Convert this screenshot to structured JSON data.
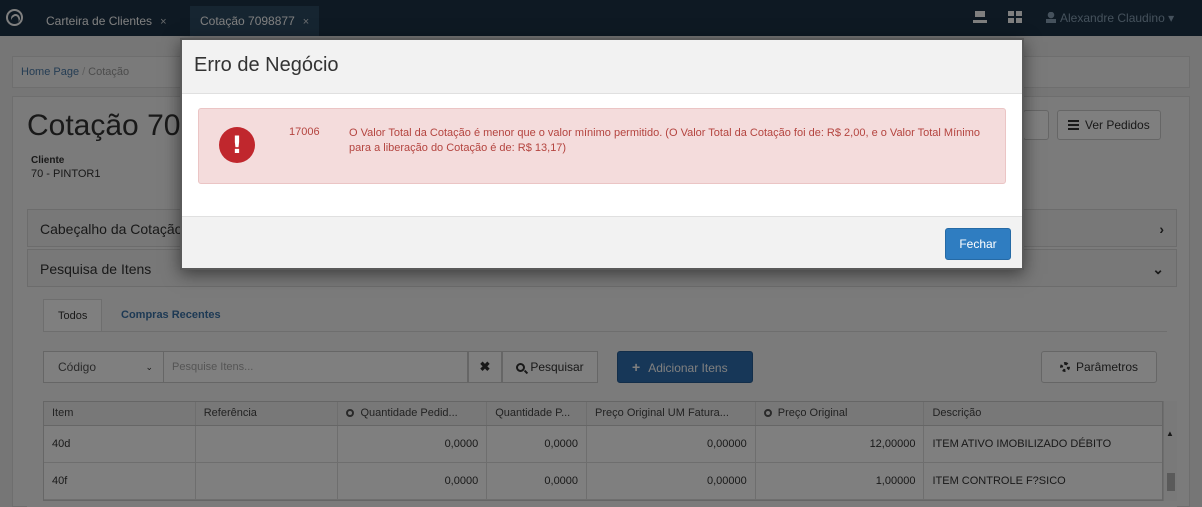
{
  "topbar": {
    "tabs": [
      {
        "label": "Carteira de Clientes",
        "close": "×"
      },
      {
        "label": "Cotação 7098877",
        "close": "×"
      }
    ],
    "user": "Alexandre Claudino",
    "user_caret": "▾"
  },
  "breadcrumb": {
    "home": "Home Page",
    "sep": "/",
    "current": "Cotação"
  },
  "page": {
    "title": "Cotação 7098877",
    "client_label": "Cliente",
    "client_value": "70 - PINTOR1",
    "btn_pedidos": "Ver Pedidos"
  },
  "panels": [
    {
      "title": "Cabeçalho da Cotação",
      "chevron": "›"
    },
    {
      "title": "Pesquisa de Itens",
      "chevron": "⌄"
    }
  ],
  "subtabs": {
    "todos": "Todos",
    "recentes": "Compras Recentes"
  },
  "search": {
    "field": "Código",
    "caret": "⌄",
    "placeholder": "Pesquise Itens...",
    "clear": "✖",
    "button": "Pesquisar",
    "add_button": "Adicionar Itens",
    "plus": "+",
    "params_button": "Parâmetros"
  },
  "table": {
    "headers": [
      "Item",
      "Referência",
      "Quantidade Pedid...",
      "Quantidade P...",
      "Preço Original UM Fatura...",
      "Preço Original",
      "Descrição"
    ],
    "rows": [
      {
        "item": "40d",
        "ref": "",
        "qtd": "0,0000",
        "qtdp": "0,0000",
        "pum": "0,00000",
        "po": "12,00000",
        "desc": "ITEM ATIVO IMOBILIZADO DÉBITO"
      },
      {
        "item": "40f",
        "ref": "",
        "qtd": "0,0000",
        "qtdp": "0,0000",
        "pum": "0,00000",
        "po": "1,00000",
        "desc": "ITEM CONTROLE F?SICO"
      }
    ]
  },
  "modal": {
    "title": "Erro de Negócio",
    "icon_glyph": "!",
    "code": "17006",
    "message": "O Valor Total da Cotação é menor que o valor mínimo permitido. (O Valor Total da Cotação foi de: R$ 2,00, e o Valor Total Mínimo para a liberação do Cotação é de: R$ 13,17)",
    "close_button": "Fechar"
  },
  "colors": {
    "topbar": "#1d3346",
    "primary": "#2f7dc1",
    "danger": "#c0272d",
    "alert_bg": "#f4dcdc"
  }
}
